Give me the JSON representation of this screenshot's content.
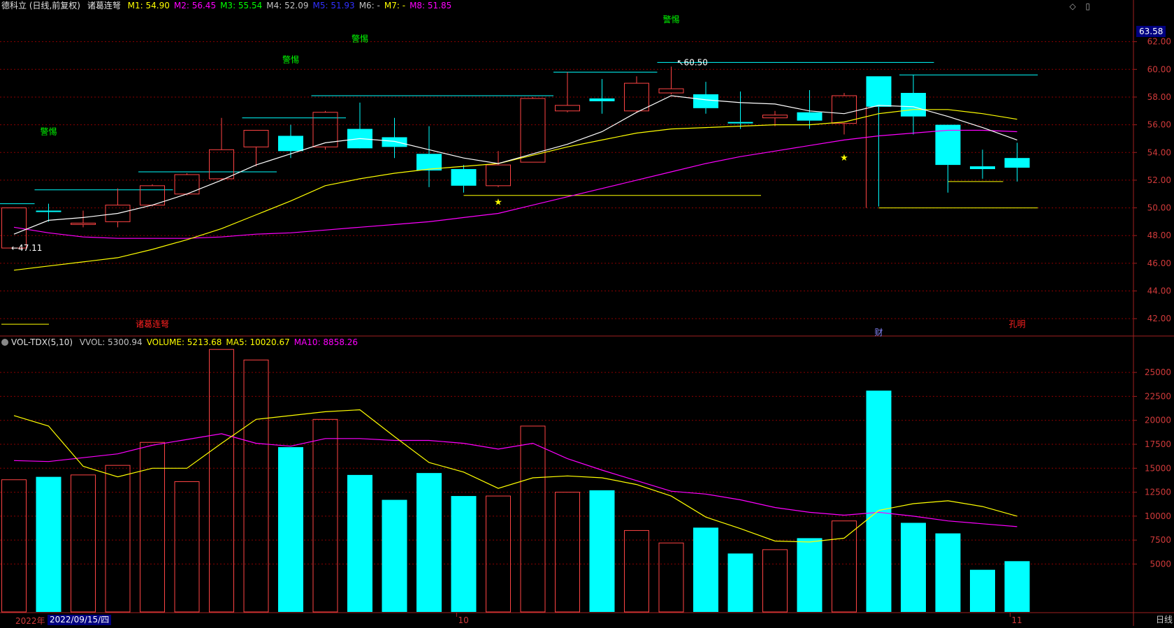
{
  "header": {
    "stock_title": "德科立 (日线,前复权)",
    "indicator_name": "诸葛连弩",
    "ma_labels": [
      {
        "text": "M1: 54.90",
        "color": "#ffff00"
      },
      {
        "text": "M2: 56.45",
        "color": "#ff00ff"
      },
      {
        "text": "M3: 55.54",
        "color": "#00ff00"
      },
      {
        "text": "M4: 52.09",
        "color": "#c0c0c0"
      },
      {
        "text": "M5: 51.93",
        "color": "#3030ff"
      },
      {
        "text": "M6: -",
        "color": "#c0c0c0"
      },
      {
        "text": "M7: -",
        "color": "#ffff00"
      },
      {
        "text": "M8: 51.85",
        "color": "#ff00ff"
      }
    ],
    "vol_title": "VOL-TDX(5,10)",
    "vol_labels": [
      {
        "text": "VVOL: 5300.94",
        "color": "#c0c0c0"
      },
      {
        "text": "VOLUME: 5213.68",
        "color": "#ffff00"
      },
      {
        "text": "MA5: 10020.67",
        "color": "#ffff00"
      },
      {
        "text": "MA10: 8858.26",
        "color": "#ff00ff"
      }
    ]
  },
  "footer": {
    "year_label": "2022年",
    "selected_date": "2022/09/15/四",
    "month_labels": [
      "10",
      "11"
    ],
    "period": "日线"
  },
  "current_price": "63.58",
  "colors": {
    "up": "#ff4444",
    "down": "#00ffff",
    "ma_white": "#ffffff",
    "ma_yellow": "#ffff00",
    "ma_magenta": "#ff00ff",
    "grid": "#8b0000",
    "level_cyan": "#00ffff",
    "level_yellow": "#ffff00",
    "signal_green": "#00ff00",
    "signal_red": "#ff2020"
  },
  "chart_data": [
    {
      "type": "candlestick",
      "title": "德科立 (日线,前复权)",
      "ylim": [
        41,
        64
      ],
      "y_ticks": [
        42.0,
        44.0,
        46.0,
        48.0,
        50.0,
        52.0,
        54.0,
        56.0,
        58.0,
        60.0,
        62.0
      ],
      "candles": [
        {
          "o": 47.1,
          "h": 50.0,
          "l": 47.1,
          "c": 50.0
        },
        {
          "o": 49.8,
          "h": 50.3,
          "l": 49.0,
          "c": 49.7
        },
        {
          "o": 48.8,
          "h": 49.8,
          "l": 48.6,
          "c": 48.9
        },
        {
          "o": 49.0,
          "h": 51.4,
          "l": 48.6,
          "c": 50.2
        },
        {
          "o": 50.2,
          "h": 51.7,
          "l": 50.1,
          "c": 51.6
        },
        {
          "o": 51.0,
          "h": 52.5,
          "l": 50.9,
          "c": 52.4
        },
        {
          "o": 52.1,
          "h": 56.5,
          "l": 52.0,
          "c": 54.2
        },
        {
          "o": 54.4,
          "h": 55.6,
          "l": 53.0,
          "c": 55.6
        },
        {
          "o": 55.2,
          "h": 56.0,
          "l": 53.6,
          "c": 54.1
        },
        {
          "o": 54.4,
          "h": 57.0,
          "l": 54.2,
          "c": 56.9
        },
        {
          "o": 55.7,
          "h": 57.6,
          "l": 54.5,
          "c": 54.3
        },
        {
          "o": 55.1,
          "h": 56.5,
          "l": 53.6,
          "c": 54.4
        },
        {
          "o": 53.9,
          "h": 55.9,
          "l": 51.5,
          "c": 52.7
        },
        {
          "o": 52.8,
          "h": 53.1,
          "l": 51.1,
          "c": 51.6
        },
        {
          "o": 51.6,
          "h": 54.1,
          "l": 51.5,
          "c": 53.1
        },
        {
          "o": 53.3,
          "h": 58.0,
          "l": 53.3,
          "c": 57.9
        },
        {
          "o": 57.0,
          "h": 59.8,
          "l": 56.9,
          "c": 57.4
        },
        {
          "o": 57.9,
          "h": 59.3,
          "l": 56.8,
          "c": 57.7
        },
        {
          "o": 57.0,
          "h": 59.5,
          "l": 56.9,
          "c": 59.0
        },
        {
          "o": 58.3,
          "h": 60.2,
          "l": 58.2,
          "c": 58.6
        },
        {
          "o": 58.2,
          "h": 59.1,
          "l": 56.8,
          "c": 57.2
        },
        {
          "o": 56.2,
          "h": 58.4,
          "l": 55.7,
          "c": 56.1
        },
        {
          "o": 56.5,
          "h": 57.0,
          "l": 55.9,
          "c": 56.7
        },
        {
          "o": 56.9,
          "h": 58.5,
          "l": 55.7,
          "c": 56.3
        },
        {
          "o": 56.1,
          "h": 58.3,
          "l": 55.3,
          "c": 58.1
        },
        {
          "o": 59.5,
          "h": 59.5,
          "l": 50.1,
          "c": 57.3
        },
        {
          "o": 58.3,
          "h": 59.6,
          "l": 55.3,
          "c": 56.6
        },
        {
          "o": 56.0,
          "h": 56.0,
          "l": 51.1,
          "c": 53.1
        },
        {
          "o": 53.0,
          "h": 54.2,
          "l": 52.1,
          "c": 52.8
        },
        {
          "o": 53.6,
          "h": 54.7,
          "l": 51.9,
          "c": 52.9
        }
      ],
      "ma_white": [
        48.1,
        49.1,
        49.3,
        49.6,
        50.2,
        51.0,
        52.0,
        53.1,
        53.9,
        54.7,
        55.0,
        54.8,
        54.2,
        53.6,
        53.2,
        53.9,
        54.6,
        55.5,
        56.9,
        58.1,
        57.8,
        57.6,
        57.5,
        57.0,
        56.8,
        57.4,
        57.3,
        56.6,
        55.8,
        54.9
      ],
      "ma_yellow": [
        45.5,
        45.8,
        46.1,
        46.4,
        47.0,
        47.7,
        48.5,
        49.5,
        50.5,
        51.6,
        52.1,
        52.5,
        52.8,
        53.0,
        53.2,
        53.8,
        54.4,
        54.9,
        55.4,
        55.7,
        55.8,
        55.9,
        56.0,
        56.0,
        56.2,
        56.8,
        57.1,
        57.1,
        56.8,
        56.4
      ],
      "ma_magenta": [
        48.6,
        48.2,
        47.9,
        47.8,
        47.8,
        47.8,
        47.9,
        48.1,
        48.2,
        48.4,
        48.6,
        48.8,
        49.0,
        49.3,
        49.6,
        50.2,
        50.8,
        51.4,
        52.0,
        52.6,
        53.2,
        53.7,
        54.1,
        54.5,
        54.9,
        55.2,
        55.4,
        55.6,
        55.6,
        55.5
      ],
      "cyan_levels": [
        {
          "price": 50.3,
          "from": 0,
          "to": 1
        },
        {
          "price": 51.3,
          "from": 1,
          "to": 5
        },
        {
          "price": 52.6,
          "from": 4,
          "to": 8
        },
        {
          "price": 56.5,
          "from": 7,
          "to": 10
        },
        {
          "price": 58.1,
          "from": 9,
          "to": 16
        },
        {
          "price": 59.8,
          "from": 16,
          "to": 19
        },
        {
          "price": 60.5,
          "from": 19,
          "to": 27
        },
        {
          "price": 59.6,
          "from": 26,
          "to": 30
        }
      ],
      "yellow_levels": [
        {
          "price": 50.9,
          "from": 13,
          "to": 22
        },
        {
          "price": 50.0,
          "from": 25,
          "to": 30
        },
        {
          "price": 51.9,
          "from": 27,
          "to": 29
        }
      ],
      "annotations": [
        {
          "text": "警惕",
          "bar": 1,
          "price": 55.5,
          "color": "#00ff00"
        },
        {
          "text": "警惕",
          "bar": 8,
          "price": 60.7,
          "color": "#00ff00"
        },
        {
          "text": "警惕",
          "bar": 10,
          "price": 62.2,
          "color": "#00ff00"
        },
        {
          "text": "警惕",
          "bar": 19,
          "price": 63.6,
          "color": "#00ff00"
        },
        {
          "text": "60.50",
          "bar": 19,
          "price": 60.5,
          "color": "#ffffff"
        },
        {
          "text": "47.11",
          "bar": 0,
          "price": 47.1,
          "color": "#ffffff"
        },
        {
          "text": "★",
          "bar": 14,
          "price": 50.4,
          "color": "#ffff00"
        },
        {
          "text": "★",
          "bar": 24,
          "price": 53.6,
          "color": "#ffff00"
        },
        {
          "text": "诸葛连弩",
          "bar": 4,
          "price": 41.6,
          "color": "#ff2020"
        },
        {
          "text": "孔明",
          "bar": 29,
          "price": 41.6,
          "color": "#ff2020"
        },
        {
          "text": "财",
          "bar": 25,
          "price": 41.0,
          "color": "#8888ff"
        }
      ]
    },
    {
      "type": "bar",
      "title": "VOL-TDX(5,10)",
      "ylim": [
        0,
        28000
      ],
      "y_ticks": [
        5000,
        7500,
        10000,
        12500,
        15000,
        17500,
        20000,
        22500,
        25000
      ],
      "volume": [
        13800,
        14100,
        14300,
        15300,
        17700,
        13600,
        27400,
        26300,
        17200,
        20100,
        14300,
        11700,
        14500,
        12100,
        12100,
        19400,
        12500,
        12700,
        8500,
        7200,
        8800,
        6100,
        6500,
        7700,
        9500,
        23100,
        9300,
        8200,
        4400,
        5300
      ],
      "ma5": [
        20500,
        19400,
        15200,
        14100,
        15000,
        15000,
        17600,
        20100,
        20500,
        20900,
        21100,
        18300,
        15600,
        14600,
        12900,
        14000,
        14200,
        14000,
        13300,
        12100,
        9900,
        8700,
        7400,
        7300,
        7700,
        10600,
        11300,
        11600,
        11000,
        10000
      ],
      "ma10": [
        15800,
        15700,
        16100,
        16500,
        17400,
        18000,
        18600,
        17600,
        17300,
        18100,
        18100,
        17900,
        17900,
        17600,
        17000,
        17600,
        16000,
        14800,
        13700,
        12600,
        12300,
        11700,
        10900,
        10400,
        10100,
        10400,
        10000,
        9500,
        9200,
        8900
      ]
    }
  ]
}
